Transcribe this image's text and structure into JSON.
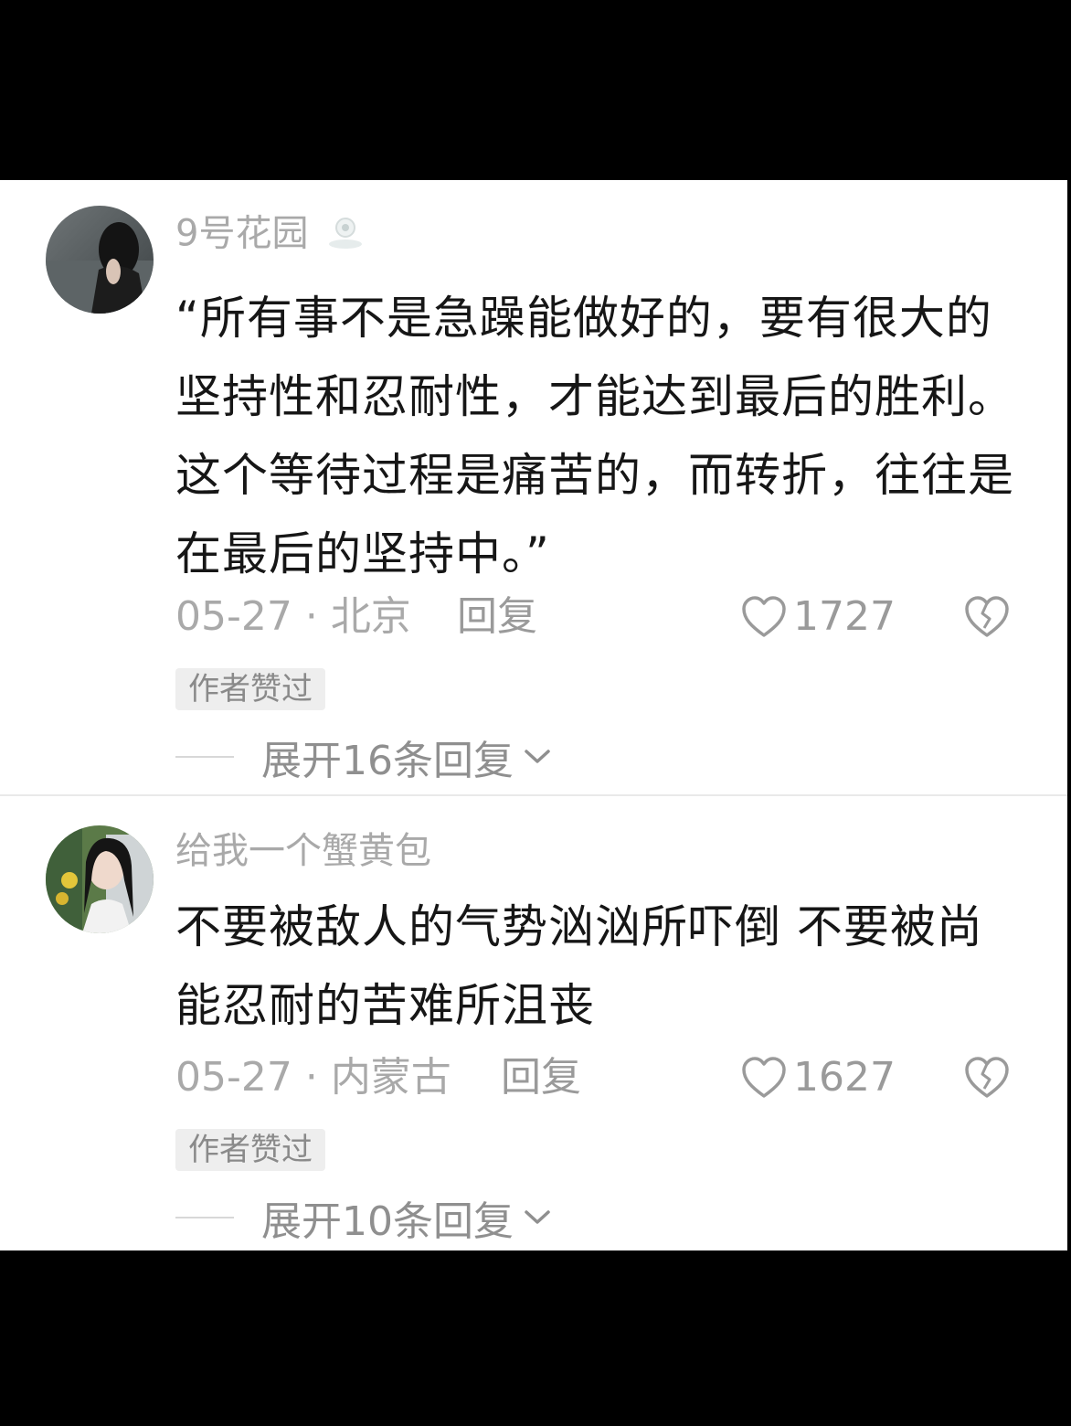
{
  "comments": [
    {
      "username": "9号花园",
      "text": "“所有事不是急躁能做好的，要有很大的坚持性和忍耐性，才能达到最后的胜利。这个等待过程是痛苦的，而转折，往往是在最后的坚持中。”",
      "date_location": "05-27 · 北京",
      "reply_label": "回复",
      "like_count": "1727",
      "author_liked": "作者赞过",
      "expand_replies": "展开16条回复"
    },
    {
      "username": "给我一个蟹黄包",
      "text": "不要被敌人的气势汹汹所吓倒 不要被尚能忍耐的苦难所沮丧",
      "date_location": "05-27 · 内蒙古",
      "reply_label": "回复",
      "like_count": "1627",
      "author_liked": "作者赞过",
      "expand_replies": "展开10条回复"
    }
  ],
  "icons": {
    "like": "heart-outline-icon",
    "dislike": "broken-heart-icon",
    "expand": "chevron-down-icon",
    "badge": "user-badge-icon"
  },
  "colors": {
    "text": "#161616",
    "muted": "#a9a9a9",
    "tag_bg": "#eeeeee",
    "letterbox": "#000000"
  }
}
